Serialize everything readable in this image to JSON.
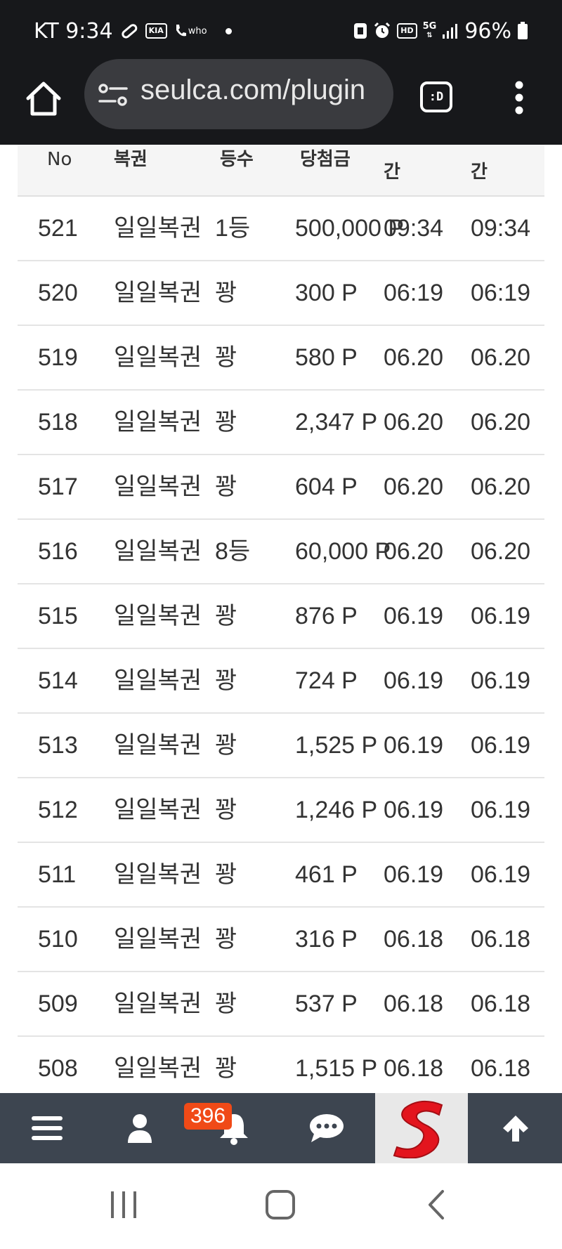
{
  "status_bar": {
    "carrier_time": "KT 9:34",
    "kia_label": "KIA",
    "who_label": "who",
    "hd_label": "HD",
    "network": "5G",
    "battery": "96%"
  },
  "browser": {
    "url": "seulca.com/plugin",
    "tab_label": ":D"
  },
  "table": {
    "headers": {
      "no": "No",
      "lottery": "복권",
      "rank": "등수",
      "prize": "당첨금",
      "time1_top": "",
      "time1_bottom": "간",
      "time2_top": "",
      "time2_bottom": "간"
    },
    "rows": [
      {
        "no": "521",
        "lottery": "일일복권",
        "rank": "1등",
        "prize": "500,000 P",
        "t1": "09:34",
        "t2": "09:34"
      },
      {
        "no": "520",
        "lottery": "일일복권",
        "rank": "꽝",
        "prize": "300 P",
        "t1": "06:19",
        "t2": "06:19"
      },
      {
        "no": "519",
        "lottery": "일일복권",
        "rank": "꽝",
        "prize": "580 P",
        "t1": "06.20",
        "t2": "06.20"
      },
      {
        "no": "518",
        "lottery": "일일복권",
        "rank": "꽝",
        "prize": "2,347 P",
        "t1": "06.20",
        "t2": "06.20"
      },
      {
        "no": "517",
        "lottery": "일일복권",
        "rank": "꽝",
        "prize": "604 P",
        "t1": "06.20",
        "t2": "06.20"
      },
      {
        "no": "516",
        "lottery": "일일복권",
        "rank": "8등",
        "prize": "60,000 P",
        "t1": "06.20",
        "t2": "06.20"
      },
      {
        "no": "515",
        "lottery": "일일복권",
        "rank": "꽝",
        "prize": "876 P",
        "t1": "06.19",
        "t2": "06.19"
      },
      {
        "no": "514",
        "lottery": "일일복권",
        "rank": "꽝",
        "prize": "724 P",
        "t1": "06.19",
        "t2": "06.19"
      },
      {
        "no": "513",
        "lottery": "일일복권",
        "rank": "꽝",
        "prize": "1,525 P",
        "t1": "06.19",
        "t2": "06.19"
      },
      {
        "no": "512",
        "lottery": "일일복권",
        "rank": "꽝",
        "prize": "1,246 P",
        "t1": "06.19",
        "t2": "06.19"
      },
      {
        "no": "511",
        "lottery": "일일복권",
        "rank": "꽝",
        "prize": "461 P",
        "t1": "06.19",
        "t2": "06.19"
      },
      {
        "no": "510",
        "lottery": "일일복권",
        "rank": "꽝",
        "prize": "316 P",
        "t1": "06.18",
        "t2": "06.18"
      },
      {
        "no": "509",
        "lottery": "일일복권",
        "rank": "꽝",
        "prize": "537 P",
        "t1": "06.18",
        "t2": "06.18"
      },
      {
        "no": "508",
        "lottery": "일일복권",
        "rank": "꽝",
        "prize": "1,515 P",
        "t1": "06.18",
        "t2": "06.18"
      }
    ]
  },
  "bottom_nav": {
    "notification_count": "396",
    "logo_letter": "S"
  },
  "colors": {
    "status_bg": "#17181b",
    "nav_bg": "#3d4550",
    "badge": "#f04a17",
    "logo_red": "#e3151e"
  }
}
